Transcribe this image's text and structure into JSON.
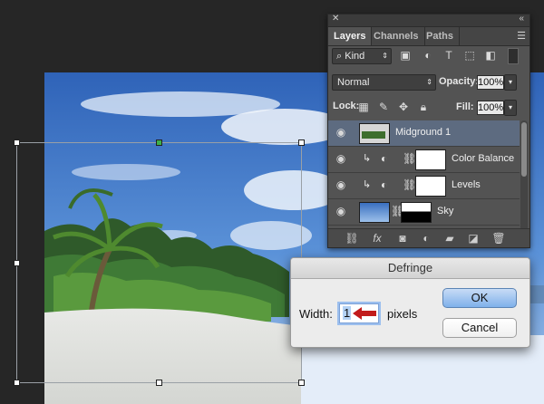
{
  "panel": {
    "tabs": [
      "Layers",
      "Channels",
      "Paths"
    ],
    "kind_label": "Kind",
    "blend_mode": "Normal",
    "opacity_label": "Opacity:",
    "opacity_value": "100%",
    "lock_label": "Lock:",
    "fill_label": "Fill:",
    "fill_value": "100%",
    "layers": [
      {
        "name": "Midground 1",
        "selected": true
      },
      {
        "name": "Color Balance",
        "selected": false
      },
      {
        "name": "Levels",
        "selected": false
      },
      {
        "name": "Sky",
        "selected": false
      }
    ],
    "footer_icons": [
      "link-layers-icon",
      "fx-icon",
      "add-mask-icon",
      "adjustment-layer-icon",
      "group-folder-icon",
      "new-layer-icon",
      "trash-icon"
    ]
  },
  "dialog": {
    "title": "Defringe",
    "width_label": "Width:",
    "width_value": "1",
    "unit_label": "pixels",
    "ok_label": "OK",
    "cancel_label": "Cancel"
  },
  "colors": {
    "panel_bg": "#535353",
    "selection": "#5d6b80",
    "ok_button": "#7fb0ea",
    "arrow": "#c21b1b"
  }
}
